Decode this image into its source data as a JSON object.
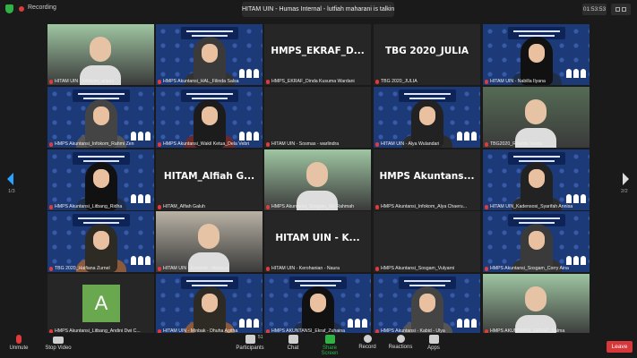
{
  "top_bar": {
    "recording_label": "Recording",
    "talking_banner": "HITAM UIN - Humas Internal - lutfiah maharani is talking...",
    "timer": "01:53:53"
  },
  "pager": {
    "left": "1/3",
    "right": "2/2"
  },
  "tiles": [
    {
      "name": "HITAM UIN - Infokom_anjani",
      "kind": "photo"
    },
    {
      "name": "HMPS Akuntansi_HAL_Filinda Salsa",
      "kind": "person"
    },
    {
      "name": "HMPS_EKRAF_Dinda Kusuma Wardani",
      "kind": "text",
      "big": "HMPS_EKRAF_D..."
    },
    {
      "name": "TBG 2020_JULIA",
      "kind": "text",
      "big": "TBG 2020_JULIA"
    },
    {
      "name": "HITAM UIN - Nabilla Ilyana",
      "kind": "person"
    },
    {
      "name": "HMPS Akuntansi_Infokom_Rahmi Zen",
      "kind": "person"
    },
    {
      "name": "HMPS Akuntansi_Wakil Ketua_Dela Vebri",
      "kind": "person"
    },
    {
      "name": "HITAM UIN - Sosmas - warlindra",
      "kind": "blank"
    },
    {
      "name": "HITAM UIN - Alya Wulandari",
      "kind": "person"
    },
    {
      "name": "TBG2020_Rivaldo Yunior",
      "kind": "photo"
    },
    {
      "name": "HMPS Akuntansi_Litbang_Ridha",
      "kind": "person"
    },
    {
      "name": "HITAM_Alfiah Galuh",
      "kind": "text",
      "big": "HITAM_Alfiah G..."
    },
    {
      "name": "HMPS Akuntansi_Sosgam_Siti Rahmah",
      "kind": "photo"
    },
    {
      "name": "HMPS Akuntansi_Infokom_Alya Chaeru...",
      "kind": "text",
      "big": "HMPS Akuntans..."
    },
    {
      "name": "HITAM UIN_Kadensosi_Syarifah Annisa",
      "kind": "person"
    },
    {
      "name": "TBG 2020_Haifiana Zurnel",
      "kind": "person"
    },
    {
      "name": "HITAM UIN - Kominfo - Mahsya",
      "kind": "photo"
    },
    {
      "name": "HITAM UIN - Kerohanian - Naura",
      "kind": "text",
      "big": "HITAM UIN -  K..."
    },
    {
      "name": "HMPS Akuntansi_Sosgam_Vulyarni",
      "kind": "blank"
    },
    {
      "name": "HMPS Akuntansi_Sosgam_Corry Aina",
      "kind": "person"
    },
    {
      "name": "HMPS Akuntansi_Litbang_Andini Dwi C...",
      "kind": "avatar",
      "initial": "A"
    },
    {
      "name": "HITAM UIN - Minbak - Dhuha Agitha",
      "kind": "person"
    },
    {
      "name": "HMPS AKUNTANSI_Ekraf_Zuhaina",
      "kind": "person"
    },
    {
      "name": "HMPS Akuntansi - Kabid - Ulya",
      "kind": "person"
    },
    {
      "name": "HMPS AKUNTANSI_EKRAF_Salma",
      "kind": "photo"
    }
  ],
  "toolbar": {
    "unmute": "Unmute",
    "stop_video": "Stop Video",
    "participants": "Participants",
    "participants_count": "51",
    "chat": "Chat",
    "share_screen": "Share Screen",
    "record": "Record",
    "reactions": "Reactions",
    "apps": "Apps",
    "leave": "Leave"
  },
  "colors": {
    "accent_blue": "#29a3ff",
    "share_green": "#2fb344",
    "leave_red": "#d9383a",
    "vbg_navy": "#1d3a78"
  }
}
